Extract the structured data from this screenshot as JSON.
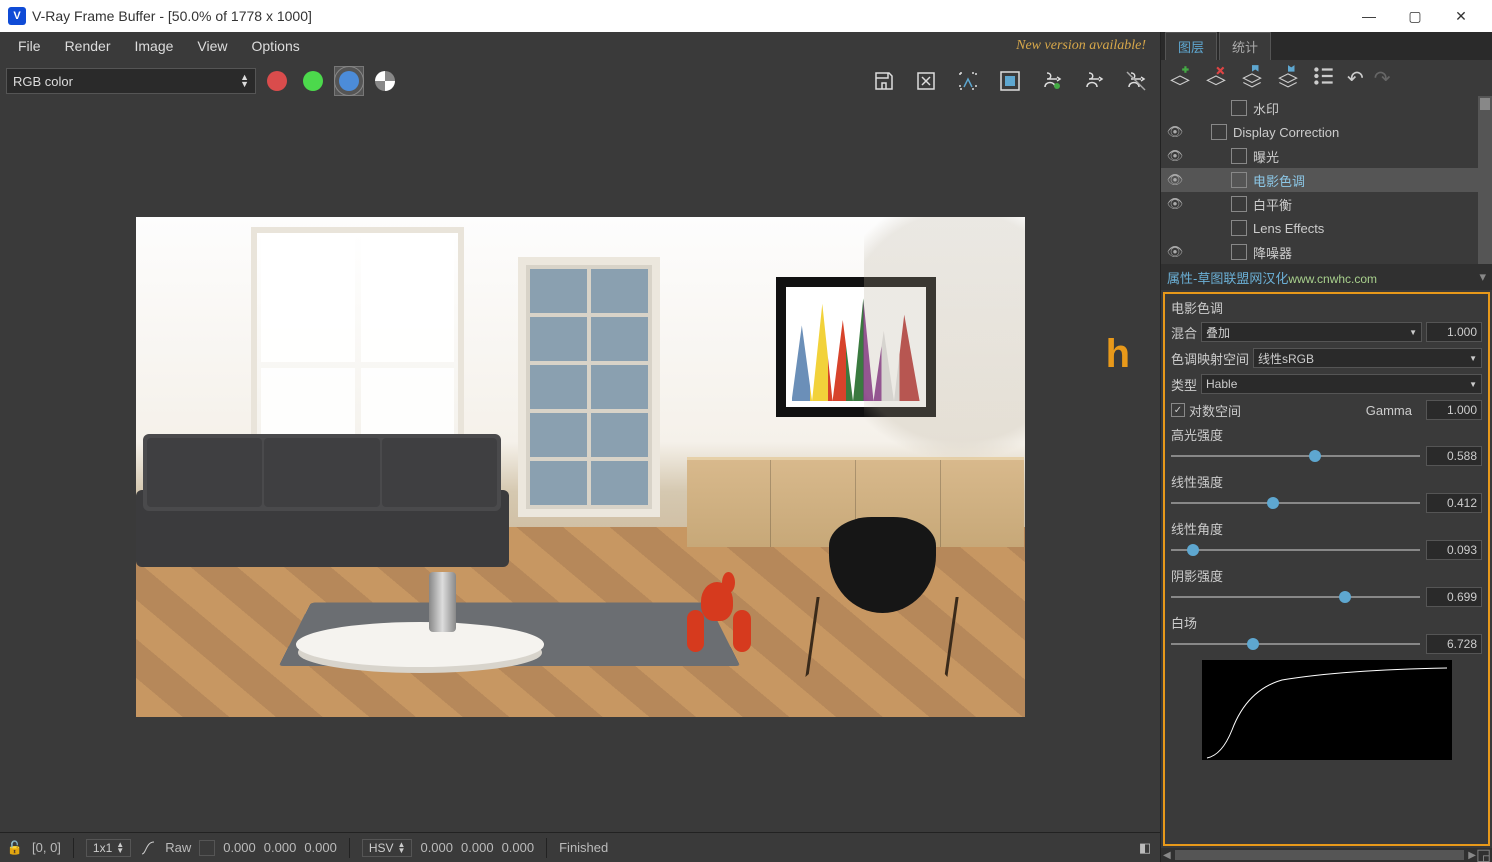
{
  "title": "V-Ray Frame Buffer - [50.0% of 1778 x 1000]",
  "menu": [
    "File",
    "Render",
    "Image",
    "View",
    "Options"
  ],
  "new_version": "New version available!",
  "channel": "RGB color",
  "viewport_marker": "h",
  "status": {
    "coords": "[0, 0]",
    "mode": "1x1",
    "raw": "Raw",
    "rgb": [
      "0.000",
      "0.000",
      "0.000"
    ],
    "colorspace": "HSV",
    "hsv": [
      "0.000",
      "0.000",
      "0.000"
    ],
    "finished": "Finished"
  },
  "tabs": {
    "layers": "图层",
    "stats": "统计"
  },
  "layers": [
    {
      "label": "水印",
      "indent": 2,
      "eye": false,
      "icon": "wm"
    },
    {
      "label": "Display Correction",
      "indent": 1,
      "eye": true,
      "icon": "dc"
    },
    {
      "label": "曝光",
      "indent": 2,
      "eye": true,
      "icon": "exp"
    },
    {
      "label": "电影色调",
      "indent": 2,
      "eye": true,
      "icon": "film",
      "selected": true
    },
    {
      "label": "白平衡",
      "indent": 2,
      "eye": true,
      "icon": "wb"
    },
    {
      "label": "Lens Effects",
      "indent": 2,
      "eye": false,
      "icon": "lens"
    },
    {
      "label": "降噪器",
      "indent": 2,
      "eye": true,
      "icon": "dn"
    }
  ],
  "prop_header": {
    "left": "属性-草图联盟网汉化",
    "right": "www.cnwhc.com"
  },
  "properties": {
    "title": "电影色调",
    "blend_label": "混合",
    "blend_mode": "叠加",
    "blend_value": "1.000",
    "tonespace_label": "色调映射空间",
    "tonespace_value": "线性sRGB",
    "type_label": "类型",
    "type_value": "Hable",
    "log_label": "对数空间",
    "log_checked": true,
    "gamma_label": "Gamma",
    "gamma_value": "1.000",
    "sliders": [
      {
        "label": "高光强度",
        "value": "0.588",
        "pos": 58
      },
      {
        "label": "线性强度",
        "value": "0.412",
        "pos": 41
      },
      {
        "label": "线性角度",
        "value": "0.093",
        "pos": 9
      },
      {
        "label": "阴影强度",
        "value": "0.699",
        "pos": 70
      },
      {
        "label": "白场",
        "value": "6.728",
        "pos": 33
      }
    ]
  }
}
